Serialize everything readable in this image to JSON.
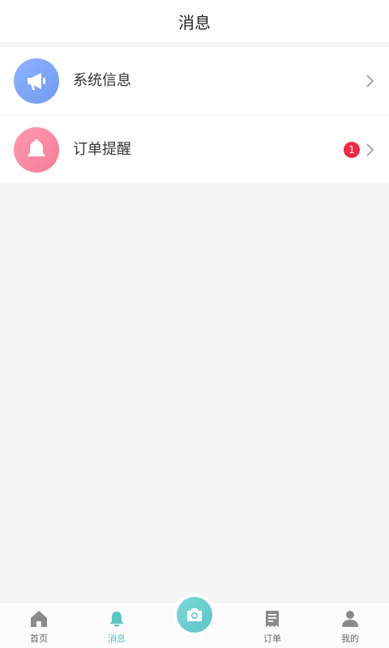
{
  "header": {
    "title": "消息"
  },
  "messages": [
    {
      "label": "系统信息",
      "icon": "megaphone-icon",
      "color": "#7aa3f5"
    },
    {
      "label": "订单提醒",
      "icon": "bell-icon",
      "color": "#f7809b",
      "badge": "1"
    }
  ],
  "tabbar": {
    "items": [
      {
        "label": "首页",
        "icon": "home-icon",
        "active": false
      },
      {
        "label": "消息",
        "icon": "bell-icon",
        "active": true
      },
      {
        "label": "",
        "icon": "camera-icon",
        "active": false
      },
      {
        "label": "订单",
        "icon": "order-document-icon",
        "active": false
      },
      {
        "label": "我的",
        "icon": "person-icon",
        "active": false
      }
    ],
    "active_color": "#5bc6c6",
    "inactive_color": "#666666"
  }
}
